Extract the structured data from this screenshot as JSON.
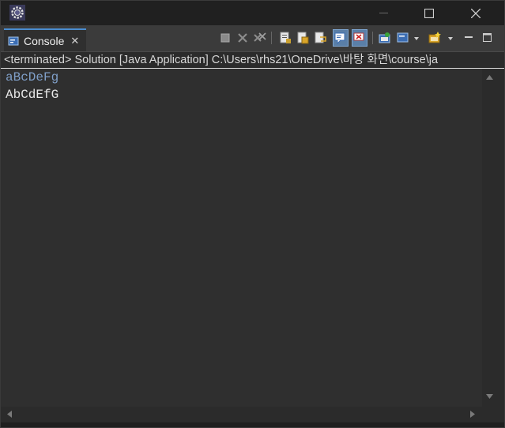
{
  "titlebar": {
    "icon": "eclipse-gear-icon",
    "minimize": "minimize-icon",
    "maximize": "maximize-icon",
    "close": "close-icon"
  },
  "view": {
    "tab_label": "Console",
    "tab_icon": "console-icon",
    "tab_close": "✕"
  },
  "toolbar": {
    "buttons": [
      "terminate-icon",
      "remove-launch-icon",
      "remove-all-terminated-icon",
      "clear-console-icon",
      "scroll-lock-icon",
      "word-wrap-icon",
      "show-on-stdout-icon",
      "show-on-stderr-icon",
      "pin-console-icon",
      "display-selected-console-icon",
      "open-console-icon"
    ]
  },
  "description": "<terminated> Solution [Java Application] C:\\Users\\rhs21\\OneDrive\\바탕 화면\\course\\ja",
  "console": {
    "lines": [
      {
        "type": "input",
        "text": "aBcDeFg"
      },
      {
        "type": "output",
        "text": "AbCdEfG"
      }
    ]
  },
  "colors": {
    "input_text": "#7f9fc8",
    "output_text": "#e8e8e8",
    "background": "#2f2f2f",
    "tab_accent": "#4a8ccf"
  }
}
